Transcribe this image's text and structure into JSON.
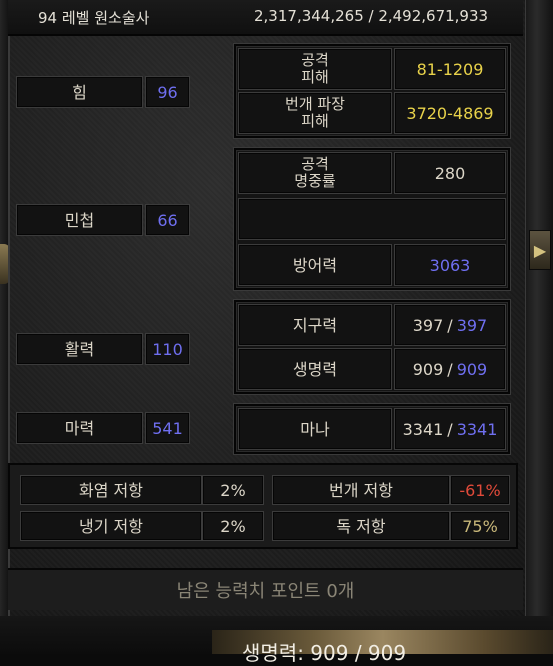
{
  "header": {
    "level_class": "94 레벨 원소술사",
    "experience": "2,317,344,265 / 2,492,671,933"
  },
  "attributes": [
    {
      "label": "힘",
      "value": "96"
    },
    {
      "label": "민첩",
      "value": "66"
    },
    {
      "label": "활력",
      "value": "110"
    },
    {
      "label": "마력",
      "value": "541"
    }
  ],
  "combat": {
    "attack_damage_label": "공격\n피해",
    "attack_damage_value": "81-1209",
    "lightning_damage_label": "번개 파장\n피해",
    "lightning_damage_value": "3720-4869",
    "attack_rating_label": "공격\n명중률",
    "attack_rating_value": "280",
    "defense_label": "방어력",
    "defense_value": "3063"
  },
  "vitals": {
    "stamina_label": "지구력",
    "stamina_current": "397",
    "stamina_max": "397",
    "life_label": "생명력",
    "life_current": "909",
    "life_max": "909",
    "mana_label": "마나",
    "mana_current": "3341",
    "mana_max": "3341",
    "separator": "/"
  },
  "resistances": [
    {
      "label": "화염 저항",
      "value": "2%"
    },
    {
      "label": "번개 저항",
      "value": "-61%"
    },
    {
      "label": "냉기 저항",
      "value": "2%"
    },
    {
      "label": "독 저항",
      "value": "75%"
    }
  ],
  "remaining_points": "남은 능력치 포인트 0개",
  "footer_text": "생명력: 909 / 909",
  "colors": {
    "yellow": "#e8d24a",
    "blue": "#6f6ff0",
    "red": "#e04a3a",
    "gold": "#c9b87a"
  }
}
